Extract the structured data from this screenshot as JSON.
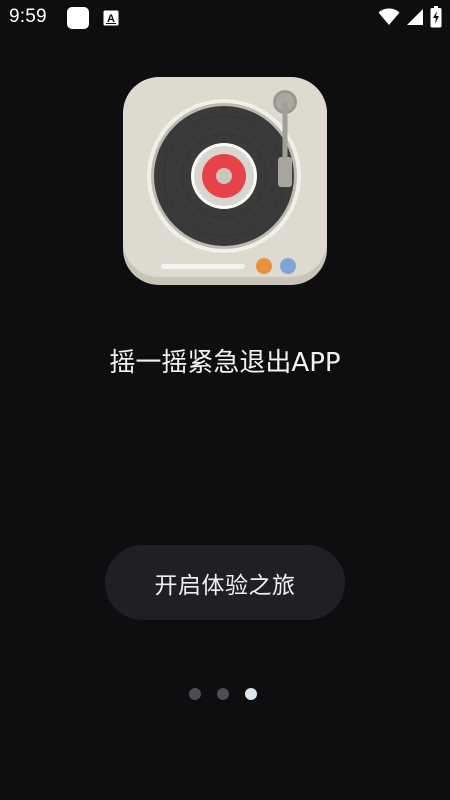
{
  "status_bar": {
    "time": "9:59",
    "notification_icons": [
      "app-notification-icon",
      "font-a-icon"
    ],
    "status_icons": [
      "wifi-icon",
      "cellular-signal-icon",
      "battery-charging-icon"
    ]
  },
  "onboarding": {
    "illustration_icon": "turntable-icon",
    "headline": "摇一摇紧急退出APP",
    "button_label": "开启体验之旅",
    "page_indicator": {
      "total": 3,
      "current": 3
    }
  },
  "colors": {
    "background": "#0e0e10",
    "button_bg": "#1f2024",
    "dot_inactive": "#4a4d52",
    "dot_active": "#dde6ee",
    "record_center": "#e8434a",
    "accent_orange": "#e8923a",
    "accent_blue": "#7ea4d8"
  }
}
